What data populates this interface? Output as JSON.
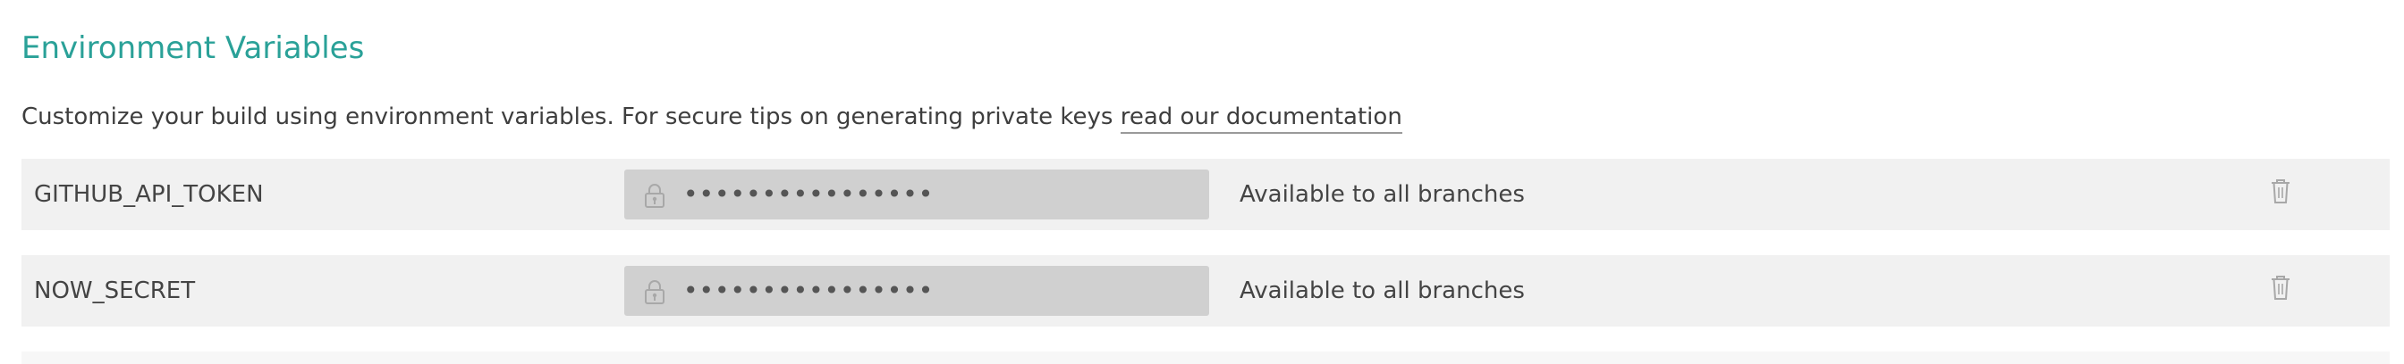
{
  "colors": {
    "heading": "#2aa198",
    "row_background": "#f1f1f1",
    "field_background": "#d0d0d0",
    "icon": "#a8a8a8"
  },
  "section": {
    "title": "Environment Variables",
    "description_text": "Customize your build using environment variables. For secure tips on generating private keys ",
    "documentation_link": "read our documentation"
  },
  "variables": [
    {
      "name": "GITHUB_API_TOKEN",
      "masked_value": "••••••••••••••••",
      "value_icon": "lock-icon",
      "availability": "Available to all branches",
      "delete_icon": "trash-icon"
    },
    {
      "name": "NOW_SECRET",
      "masked_value": "••••••••••••••••",
      "value_icon": "lock-icon",
      "availability": "Available to all branches",
      "delete_icon": "trash-icon"
    }
  ]
}
